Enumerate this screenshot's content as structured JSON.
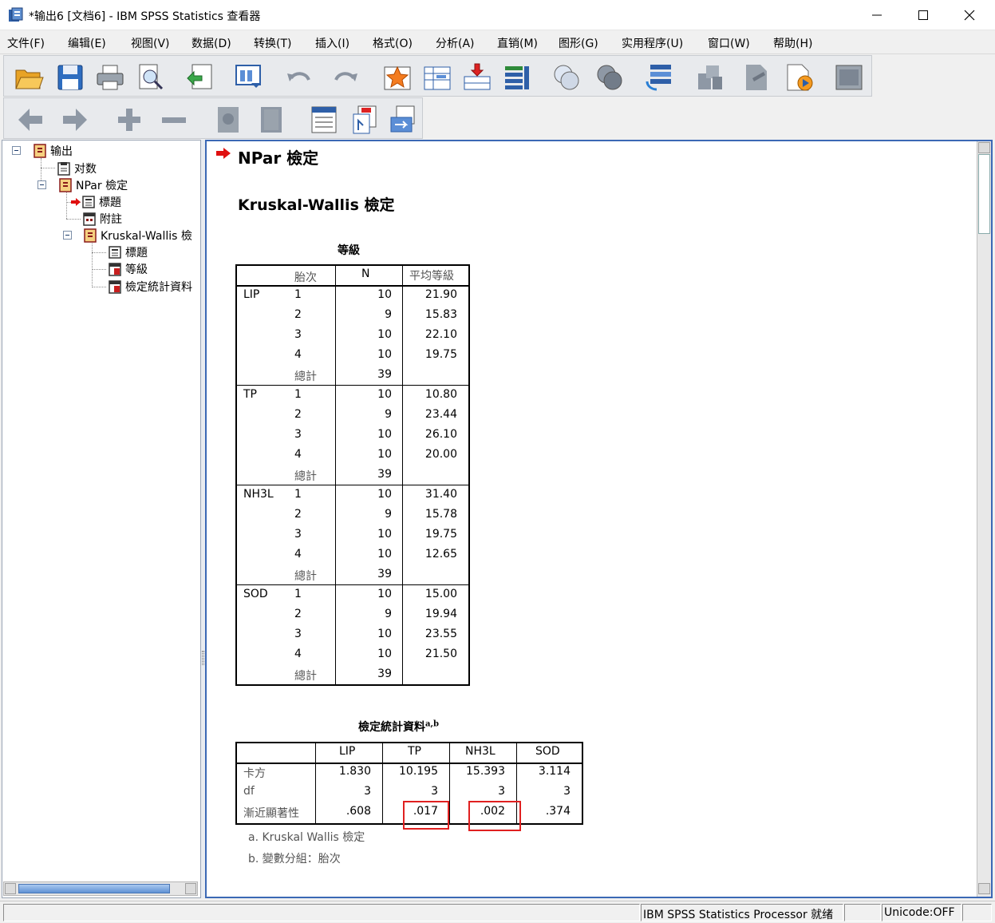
{
  "window": {
    "title": "*输出6 [文档6] - IBM SPSS Statistics 查看器"
  },
  "menu": [
    "文件(F)",
    "编辑(E)",
    "视图(V)",
    "数据(D)",
    "转换(T)",
    "插入(I)",
    "格式(O)",
    "分析(A)",
    "直销(M)",
    "图形(G)",
    "实用程序(U)",
    "窗口(W)",
    "帮助(H)"
  ],
  "toolbar1_icons": [
    "open-icon",
    "save-icon",
    "print-icon",
    "print-preview-icon",
    "export-icon",
    "recall-dialog-icon",
    "undo-icon",
    "redo-icon",
    "goto-data-icon",
    "goto-case-icon",
    "insert-cases-icon",
    "variables-icon",
    "select-cases-icon",
    "weight-cases-icon",
    "value-labels-icon",
    "use-sets-icon",
    "designate-window-icon",
    "edit-icon",
    "script-icon",
    "disabled-window-icon"
  ],
  "toolbar2_icons": [
    "back-icon",
    "forward-icon",
    "expand-icon",
    "collapse-icon",
    "show-icon",
    "hide-icon",
    "insert-heading-icon",
    "insert-title-icon",
    "insert-text-icon"
  ],
  "outline": {
    "root": "输出",
    "log": "对数",
    "npar": "NPar 檢定",
    "title1": "標題",
    "notes": "附註",
    "kw": "Kruskal-Wallis 檢",
    "title2": "標題",
    "ranks": "等級",
    "teststats": "檢定統計資料"
  },
  "content": {
    "heading": "NPar 檢定",
    "subheading": "Kruskal-Wallis 檢定",
    "ranks_table": {
      "caption": "等級",
      "headers": [
        "胎次",
        "N",
        "平均等級"
      ],
      "groups": [
        {
          "var": "LIP",
          "rows": [
            [
              "1",
              "10",
              "21.90"
            ],
            [
              "2",
              "9",
              "15.83"
            ],
            [
              "3",
              "10",
              "22.10"
            ],
            [
              "4",
              "10",
              "19.75"
            ],
            [
              "總計",
              "39",
              ""
            ]
          ]
        },
        {
          "var": "TP",
          "rows": [
            [
              "1",
              "10",
              "10.80"
            ],
            [
              "2",
              "9",
              "23.44"
            ],
            [
              "3",
              "10",
              "26.10"
            ],
            [
              "4",
              "10",
              "20.00"
            ],
            [
              "總計",
              "39",
              ""
            ]
          ]
        },
        {
          "var": "NH3L",
          "rows": [
            [
              "1",
              "10",
              "31.40"
            ],
            [
              "2",
              "9",
              "15.78"
            ],
            [
              "3",
              "10",
              "19.75"
            ],
            [
              "4",
              "10",
              "12.65"
            ],
            [
              "總計",
              "39",
              ""
            ]
          ]
        },
        {
          "var": "SOD",
          "rows": [
            [
              "1",
              "10",
              "15.00"
            ],
            [
              "2",
              "9",
              "19.94"
            ],
            [
              "3",
              "10",
              "23.55"
            ],
            [
              "4",
              "10",
              "21.50"
            ],
            [
              "總計",
              "39",
              ""
            ]
          ]
        }
      ]
    },
    "test_table": {
      "caption": "檢定統計資料",
      "caption_sup": "a,b",
      "headers": [
        "LIP",
        "TP",
        "NH3L",
        "SOD"
      ],
      "rows": [
        {
          "label": "卡方",
          "values": [
            "1.830",
            "10.195",
            "15.393",
            "3.114"
          ]
        },
        {
          "label": "df",
          "values": [
            "3",
            "3",
            "3",
            "3"
          ]
        },
        {
          "label": "漸近顯著性",
          "values": [
            ".608",
            ".017",
            ".002",
            ".374"
          ]
        }
      ],
      "footnotes": [
        "a. Kruskal Wallis 檢定",
        "b. 變數分組：胎次"
      ],
      "highlight_color": "#e02020"
    }
  },
  "status": {
    "processor": "IBM SPSS Statistics Processor 就绪",
    "unicode": "Unicode:OFF"
  }
}
